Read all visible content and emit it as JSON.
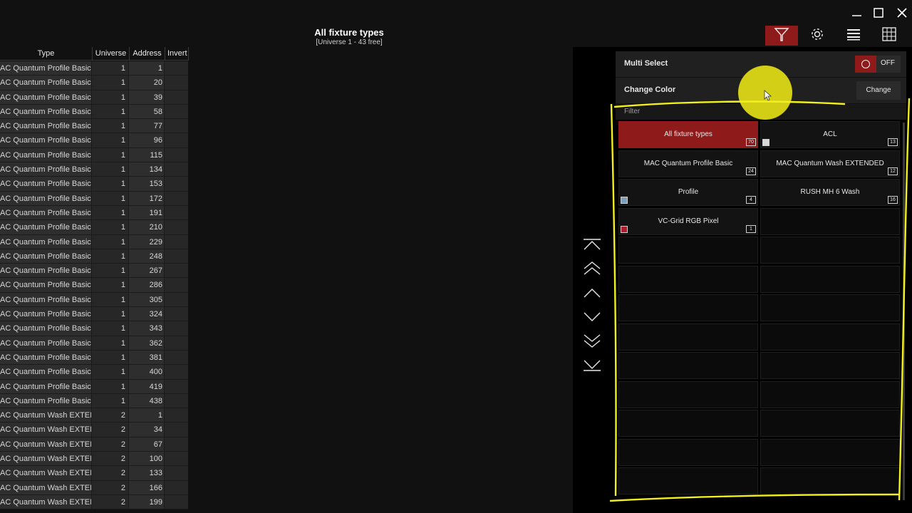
{
  "header": {
    "title": "All fixture types",
    "subtitle": "[Universe 1 - 43 free]"
  },
  "toolbar": {
    "buttons": [
      "filter-icon",
      "gear-icon",
      "list-view-icon",
      "grid-view-icon"
    ],
    "active": "filter-icon"
  },
  "window_controls": [
    "minimize-icon",
    "maximize-icon",
    "close-icon"
  ],
  "table": {
    "columns": [
      "Type",
      "Universe",
      "Address",
      "Invert"
    ],
    "rows": [
      {
        "type": "AC Quantum Profile Basic",
        "universe": "1",
        "address": "1"
      },
      {
        "type": "AC Quantum Profile Basic",
        "universe": "1",
        "address": "20"
      },
      {
        "type": "AC Quantum Profile Basic",
        "universe": "1",
        "address": "39"
      },
      {
        "type": "AC Quantum Profile Basic",
        "universe": "1",
        "address": "58"
      },
      {
        "type": "AC Quantum Profile Basic",
        "universe": "1",
        "address": "77"
      },
      {
        "type": "AC Quantum Profile Basic",
        "universe": "1",
        "address": "96"
      },
      {
        "type": "AC Quantum Profile Basic",
        "universe": "1",
        "address": "115"
      },
      {
        "type": "AC Quantum Profile Basic",
        "universe": "1",
        "address": "134"
      },
      {
        "type": "AC Quantum Profile Basic",
        "universe": "1",
        "address": "153"
      },
      {
        "type": "AC Quantum Profile Basic",
        "universe": "1",
        "address": "172"
      },
      {
        "type": "AC Quantum Profile Basic",
        "universe": "1",
        "address": "191"
      },
      {
        "type": "AC Quantum Profile Basic",
        "universe": "1",
        "address": "210"
      },
      {
        "type": "AC Quantum Profile Basic",
        "universe": "1",
        "address": "229"
      },
      {
        "type": "AC Quantum Profile Basic",
        "universe": "1",
        "address": "248"
      },
      {
        "type": "AC Quantum Profile Basic",
        "universe": "1",
        "address": "267"
      },
      {
        "type": "AC Quantum Profile Basic",
        "universe": "1",
        "address": "286"
      },
      {
        "type": "AC Quantum Profile Basic",
        "universe": "1",
        "address": "305"
      },
      {
        "type": "AC Quantum Profile Basic",
        "universe": "1",
        "address": "324"
      },
      {
        "type": "AC Quantum Profile Basic",
        "universe": "1",
        "address": "343"
      },
      {
        "type": "AC Quantum Profile Basic",
        "universe": "1",
        "address": "362"
      },
      {
        "type": "AC Quantum Profile Basic",
        "universe": "1",
        "address": "381"
      },
      {
        "type": "AC Quantum Profile Basic",
        "universe": "1",
        "address": "400"
      },
      {
        "type": "AC Quantum Profile Basic",
        "universe": "1",
        "address": "419"
      },
      {
        "type": "AC Quantum Profile Basic",
        "universe": "1",
        "address": "438"
      },
      {
        "type": "AC Quantum Wash EXTEND",
        "universe": "2",
        "address": "1"
      },
      {
        "type": "AC Quantum Wash EXTEND",
        "universe": "2",
        "address": "34"
      },
      {
        "type": "AC Quantum Wash EXTEND",
        "universe": "2",
        "address": "67"
      },
      {
        "type": "AC Quantum Wash EXTEND",
        "universe": "2",
        "address": "100"
      },
      {
        "type": "AC Quantum Wash EXTEND",
        "universe": "2",
        "address": "133"
      },
      {
        "type": "AC Quantum Wash EXTEND",
        "universe": "2",
        "address": "166"
      },
      {
        "type": "AC Quantum Wash EXTEND",
        "universe": "2",
        "address": "199"
      }
    ]
  },
  "scroll_nav": [
    "scroll-top-icon",
    "page-up-icon",
    "line-up-icon",
    "line-down-icon",
    "page-down-icon",
    "scroll-bottom-icon"
  ],
  "settings": {
    "multi_select_label": "Multi Select",
    "multi_select_state": "OFF",
    "change_color_label": "Change Color",
    "change_button": "Change",
    "filter_label": "Filter"
  },
  "filter_grid": {
    "tiles": [
      {
        "label": "All fixture types",
        "count": "70",
        "active": true
      },
      {
        "label": "ACL",
        "count": "13",
        "swatch": "#d8d8d8"
      },
      {
        "label": "MAC Quantum Profile Basic",
        "count": "24"
      },
      {
        "label": "MAC Quantum Wash EXTENDED",
        "count": "12"
      },
      {
        "label": "Profile",
        "count": "4",
        "swatch": "#7f9fb8"
      },
      {
        "label": "RUSH MH 6 Wash",
        "count": "16"
      },
      {
        "label": "VC-Grid RGB Pixel",
        "count": "1",
        "swatch": "#b01c2e"
      }
    ],
    "empty_rows": 9
  },
  "colors": {
    "accent_red": "#8e1a1a",
    "highlight_yellow": "#ece614",
    "annotation_yellow": "#f2ef1e"
  }
}
